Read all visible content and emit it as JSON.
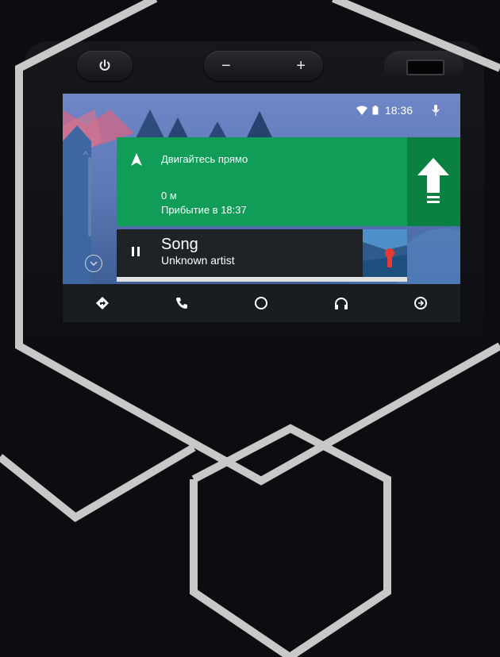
{
  "hardware": {
    "power_icon": "power-icon",
    "volume_minus": "−",
    "volume_plus": "+"
  },
  "status_bar": {
    "time": "18:36",
    "wifi_icon": "wifi-icon",
    "battery_icon": "battery-icon",
    "mic_icon": "microphone-icon"
  },
  "navigation_card": {
    "instruction": "Двигайтесь прямо",
    "distance": "0 м",
    "arrival": "Прибытие в 18:37",
    "direction_icon": "arrow-up-icon",
    "colors": {
      "primary": "#0f9d58",
      "secondary": "#0b8043"
    }
  },
  "media_card": {
    "title": "Song",
    "artist": "Unknown artist",
    "state_icon": "pause-icon",
    "progress": 0.0
  },
  "bottom_nav": [
    {
      "name": "navigation",
      "icon": "navigation-icon"
    },
    {
      "name": "phone",
      "icon": "phone-icon"
    },
    {
      "name": "home",
      "icon": "home-icon"
    },
    {
      "name": "music",
      "icon": "headphones-icon"
    },
    {
      "name": "exit",
      "icon": "exit-icon"
    }
  ],
  "colors": {
    "frame_lines": "#c8c8c8",
    "background": "#0c0d10"
  }
}
